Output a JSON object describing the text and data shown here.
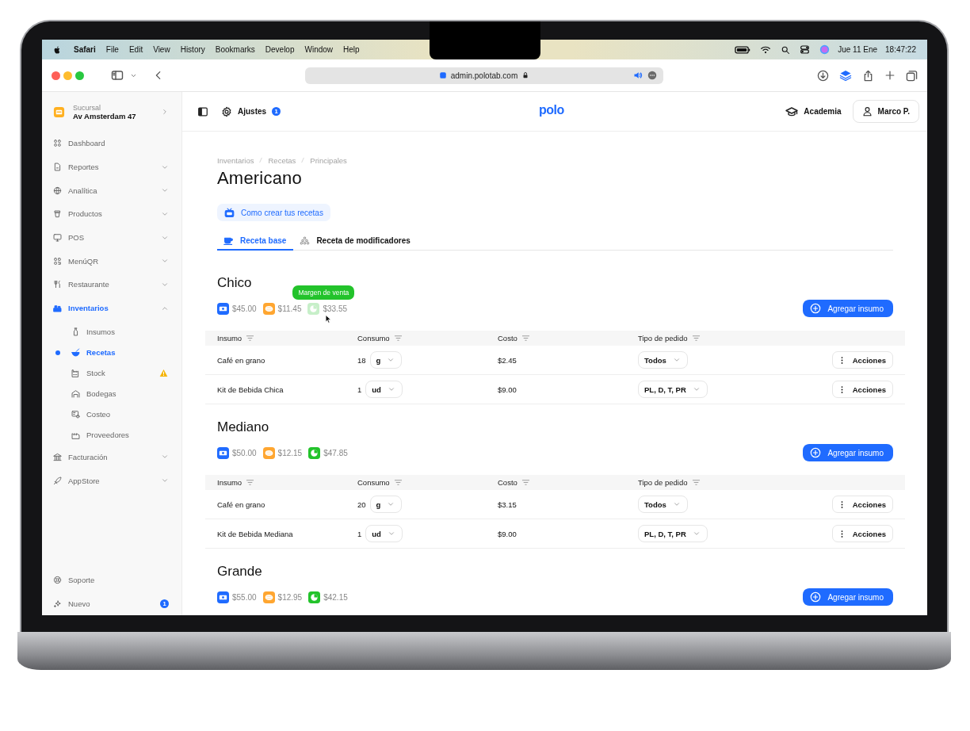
{
  "menubar": {
    "app": "Safari",
    "menus": [
      "File",
      "Edit",
      "View",
      "History",
      "Bookmarks",
      "Develop",
      "Window",
      "Help"
    ],
    "date": "Jue 11 Ene",
    "time": "18:47:22"
  },
  "browser": {
    "url": "admin.polotab.com"
  },
  "sidebar": {
    "branch_label": "Sucursal",
    "branch_name": "Av Amsterdam 47",
    "items": [
      {
        "label": "Dashboard",
        "kind": "link",
        "selected": false
      },
      {
        "label": "Reportes",
        "kind": "group",
        "selected": false,
        "expanded": false
      },
      {
        "label": "Analítica",
        "kind": "group",
        "selected": false,
        "expanded": false
      },
      {
        "label": "Productos",
        "kind": "group",
        "selected": false,
        "expanded": false
      },
      {
        "label": "POS",
        "kind": "group",
        "selected": false,
        "expanded": false
      },
      {
        "label": "MenúQR",
        "kind": "group",
        "selected": false,
        "expanded": false
      },
      {
        "label": "Restaurante",
        "kind": "group",
        "selected": false,
        "expanded": false
      },
      {
        "label": "Inventarios",
        "kind": "group",
        "selected": true,
        "expanded": true,
        "children": [
          {
            "label": "Insumos",
            "selected": false,
            "warning": false
          },
          {
            "label": "Recetas",
            "selected": true,
            "warning": false
          },
          {
            "label": "Stock",
            "selected": false,
            "warning": true
          },
          {
            "label": "Bodegas",
            "selected": false,
            "warning": false
          },
          {
            "label": "Costeo",
            "selected": false,
            "warning": false
          },
          {
            "label": "Proveedores",
            "selected": false,
            "warning": false
          }
        ]
      },
      {
        "label": "Facturación",
        "kind": "group",
        "selected": false,
        "expanded": false
      },
      {
        "label": "AppStore",
        "kind": "group",
        "selected": false,
        "expanded": false
      }
    ],
    "footer": [
      {
        "label": "Soporte"
      },
      {
        "label": "Nuevo",
        "badge": "1"
      }
    ]
  },
  "header": {
    "settings": "Ajustes",
    "settings_badge": "1",
    "logo": "polo",
    "academy": "Academia",
    "user": "Marco P."
  },
  "page": {
    "breadcrumbs": [
      "Inventarios",
      "Recetas",
      "Principales"
    ],
    "title": "Americano",
    "help_link": "Como crear tus recetas",
    "tabs": [
      {
        "label": "Receta base",
        "selected": true
      },
      {
        "label": "Receta de modificadores",
        "selected": false
      }
    ],
    "sections": [
      {
        "name": "Chico",
        "price": "$45.00",
        "cost": "$11.45",
        "margin": "$33.55",
        "margin_tooltip": "Margen de venta",
        "button": "Agregar insumo",
        "columns": [
          "Insumo",
          "Consumo",
          "Costo",
          "Tipo de pedido"
        ],
        "rows": [
          {
            "insumo": "Café en grano",
            "qty": "18",
            "unit": "g",
            "cost": "$2.45",
            "order_type": "Todos",
            "action": "Acciones"
          },
          {
            "insumo": "Kit de Bebida Chica",
            "qty": "1",
            "unit": "ud",
            "cost": "$9.00",
            "order_type": "PL, D, T, PR",
            "action": "Acciones"
          }
        ]
      },
      {
        "name": "Mediano",
        "price": "$50.00",
        "cost": "$12.15",
        "margin": "$47.85",
        "button": "Agregar insumo",
        "columns": [
          "Insumo",
          "Consumo",
          "Costo",
          "Tipo de pedido"
        ],
        "rows": [
          {
            "insumo": "Café en grano",
            "qty": "20",
            "unit": "g",
            "cost": "$3.15",
            "order_type": "Todos",
            "action": "Acciones"
          },
          {
            "insumo": "Kit de Bebida Mediana",
            "qty": "1",
            "unit": "ud",
            "cost": "$9.00",
            "order_type": "PL, D, T, PR",
            "action": "Acciones"
          }
        ]
      },
      {
        "name": "Grande",
        "price": "$55.00",
        "cost": "$12.95",
        "margin": "$42.15",
        "button": "Agregar insumo"
      }
    ]
  }
}
